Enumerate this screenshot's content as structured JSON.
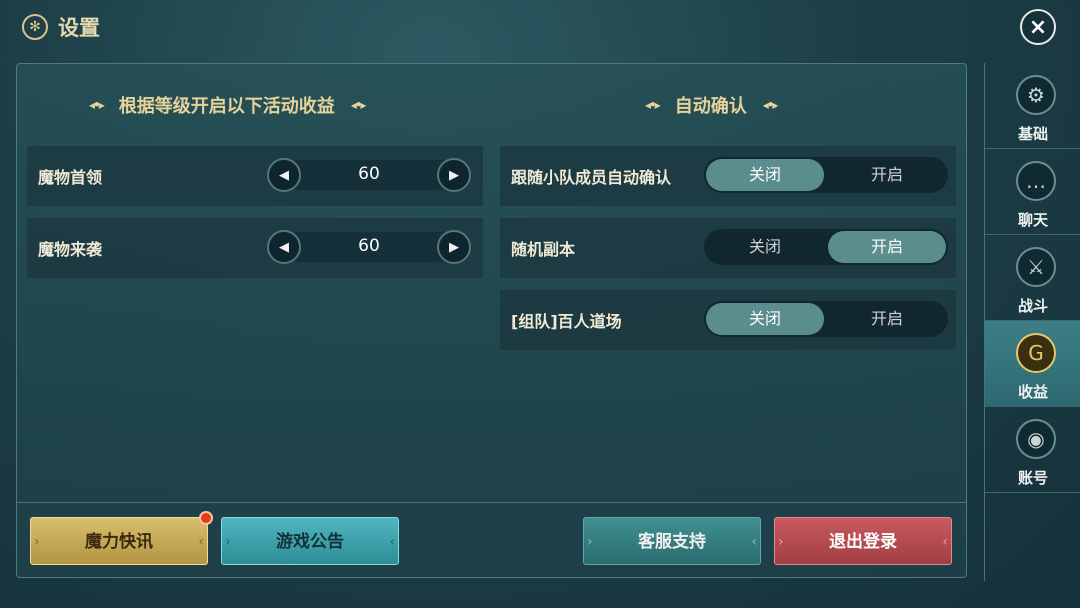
{
  "header": {
    "title": "设置",
    "close_icon": "×"
  },
  "left_section": {
    "title": "根据等级开启以下活动收益",
    "rows": [
      {
        "label": "魔物首领",
        "value": "60"
      },
      {
        "label": "魔物来袭",
        "value": "60"
      }
    ]
  },
  "right_section": {
    "title": "自动确认",
    "rows": [
      {
        "label": "跟随小队成员自动确认",
        "off": "关闭",
        "on": "开启",
        "state": "off"
      },
      {
        "label": "随机副本",
        "off": "关闭",
        "on": "开启",
        "state": "on"
      },
      {
        "label": "[组队]百人道场",
        "off": "关闭",
        "on": "开启",
        "state": "off"
      }
    ]
  },
  "buttons": {
    "news": "魔力快讯",
    "notice": "游戏公告",
    "support": "客服支持",
    "logout": "退出登录"
  },
  "sidebar": {
    "tabs": [
      {
        "label": "基础",
        "icon": "gear-icon",
        "glyph": "⚙"
      },
      {
        "label": "聊天",
        "icon": "chat-icon",
        "glyph": "…"
      },
      {
        "label": "战斗",
        "icon": "sword-icon",
        "glyph": "⚔"
      },
      {
        "label": "收益",
        "icon": "coin-icon",
        "glyph": "G",
        "active": true
      },
      {
        "label": "账号",
        "icon": "account-icon",
        "glyph": "◉"
      }
    ]
  },
  "colors": {
    "accent_gold": "#e6d29b",
    "toggle_on": "#5c8d8d",
    "logout_red": "#c95a5e"
  }
}
